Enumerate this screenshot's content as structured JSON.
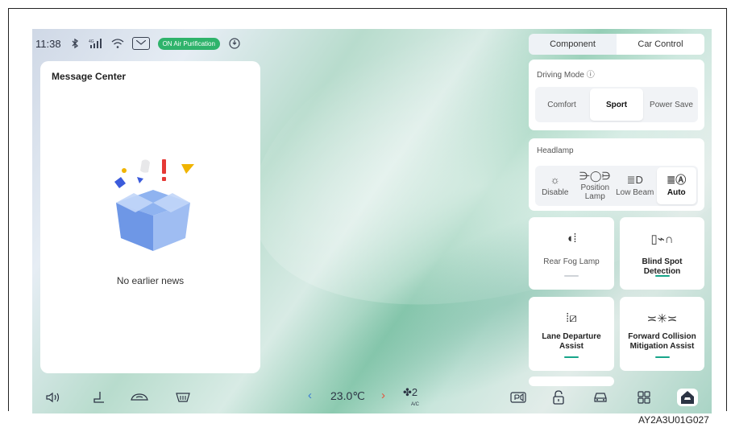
{
  "status_bar": {
    "time": "11:38",
    "bluetooth_icon": "bluetooth-icon",
    "signal_label": "4G",
    "air_purification_label": "ON Air Purification",
    "accent_color": "#2fb36b"
  },
  "message_center": {
    "title": "Message Center",
    "empty_text": "No earlier news"
  },
  "right_panel": {
    "tabs": [
      "Component",
      "Car Control"
    ],
    "active_tab": "Car Control",
    "driving_mode": {
      "title": "Driving Mode",
      "options": [
        "Comfort",
        "Sport",
        "Power Save"
      ],
      "selected": "Sport"
    },
    "headlamp": {
      "title": "Headlamp",
      "options": [
        {
          "label": "Disable",
          "icon": "headlamp-off-icon"
        },
        {
          "label": "Position Lamp",
          "icon": "position-lamp-icon"
        },
        {
          "label": "Low Beam",
          "icon": "low-beam-icon"
        },
        {
          "label": "Auto",
          "icon": "auto-headlamp-icon"
        }
      ],
      "selected": "Auto"
    },
    "tiles": [
      {
        "label": "Rear Fog Lamp",
        "icon": "rear-fog-lamp-icon",
        "on": false
      },
      {
        "label": "Blind Spot Detection",
        "icon": "blind-spot-icon",
        "on": true
      },
      {
        "label": "Lane Departure Assist",
        "icon": "lane-departure-icon",
        "on": true
      },
      {
        "label": "Forward Collision Mitigation Assist",
        "icon": "forward-collision-icon",
        "on": true
      }
    ],
    "on_color": "#17a589"
  },
  "dock": {
    "temperature": "23.0℃",
    "fan_level": "2",
    "ac_label": "A/C",
    "left_temp_color": "#3a7bd5",
    "right_temp_color": "#e5533d"
  },
  "figure_code": "AY2A3U01G027"
}
